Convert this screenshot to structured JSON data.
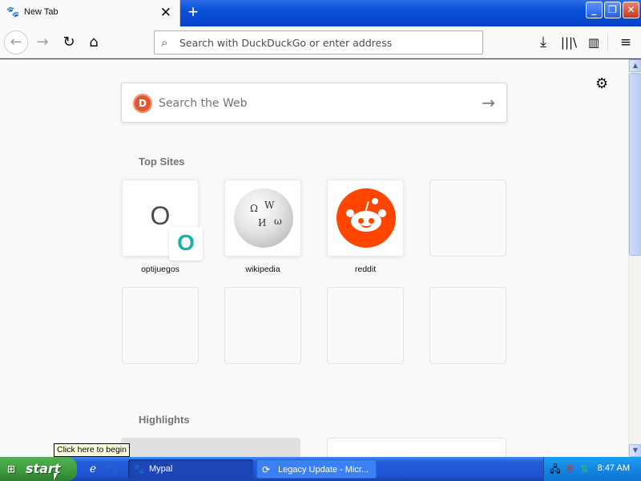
{
  "browser": {
    "tab": {
      "title": "New Tab",
      "favicon": "mypal-icon",
      "close_glyph": "✕"
    },
    "new_tab_glyph": "+",
    "window_controls": {
      "minimize": "_",
      "maximize": "❐",
      "close": "✕"
    },
    "nav": {
      "back_glyph": "←",
      "forward_glyph": "→",
      "reload_glyph": "↻",
      "home_glyph": "⌂",
      "download_glyph": "⤓",
      "library_glyph": "|||\\",
      "sidebar_glyph": "▥",
      "menu_glyph": "≡"
    },
    "urlbar": {
      "placeholder": "Search with DuckDuckGo or enter address",
      "icon": "search-icon"
    }
  },
  "newtab": {
    "settings_glyph": "⚙",
    "search": {
      "placeholder": "Search the Web",
      "engine_logo": "duckduckgo-logo",
      "arrow_glyph": "→"
    },
    "top_sites_title": "Top Sites",
    "top_sites": [
      {
        "label": "optijuegos",
        "letter": "O",
        "badge": "O"
      },
      {
        "label": "wikipedia"
      },
      {
        "label": "reddit"
      }
    ],
    "highlights_title": "Highlights"
  },
  "taskbar": {
    "start_label": "start",
    "tooltip": "Click here to begin",
    "tasks": [
      {
        "label": "Mypal",
        "active": true
      },
      {
        "label": "Legacy Update - Micr...",
        "active": false
      }
    ],
    "clock": "8:47 AM"
  }
}
